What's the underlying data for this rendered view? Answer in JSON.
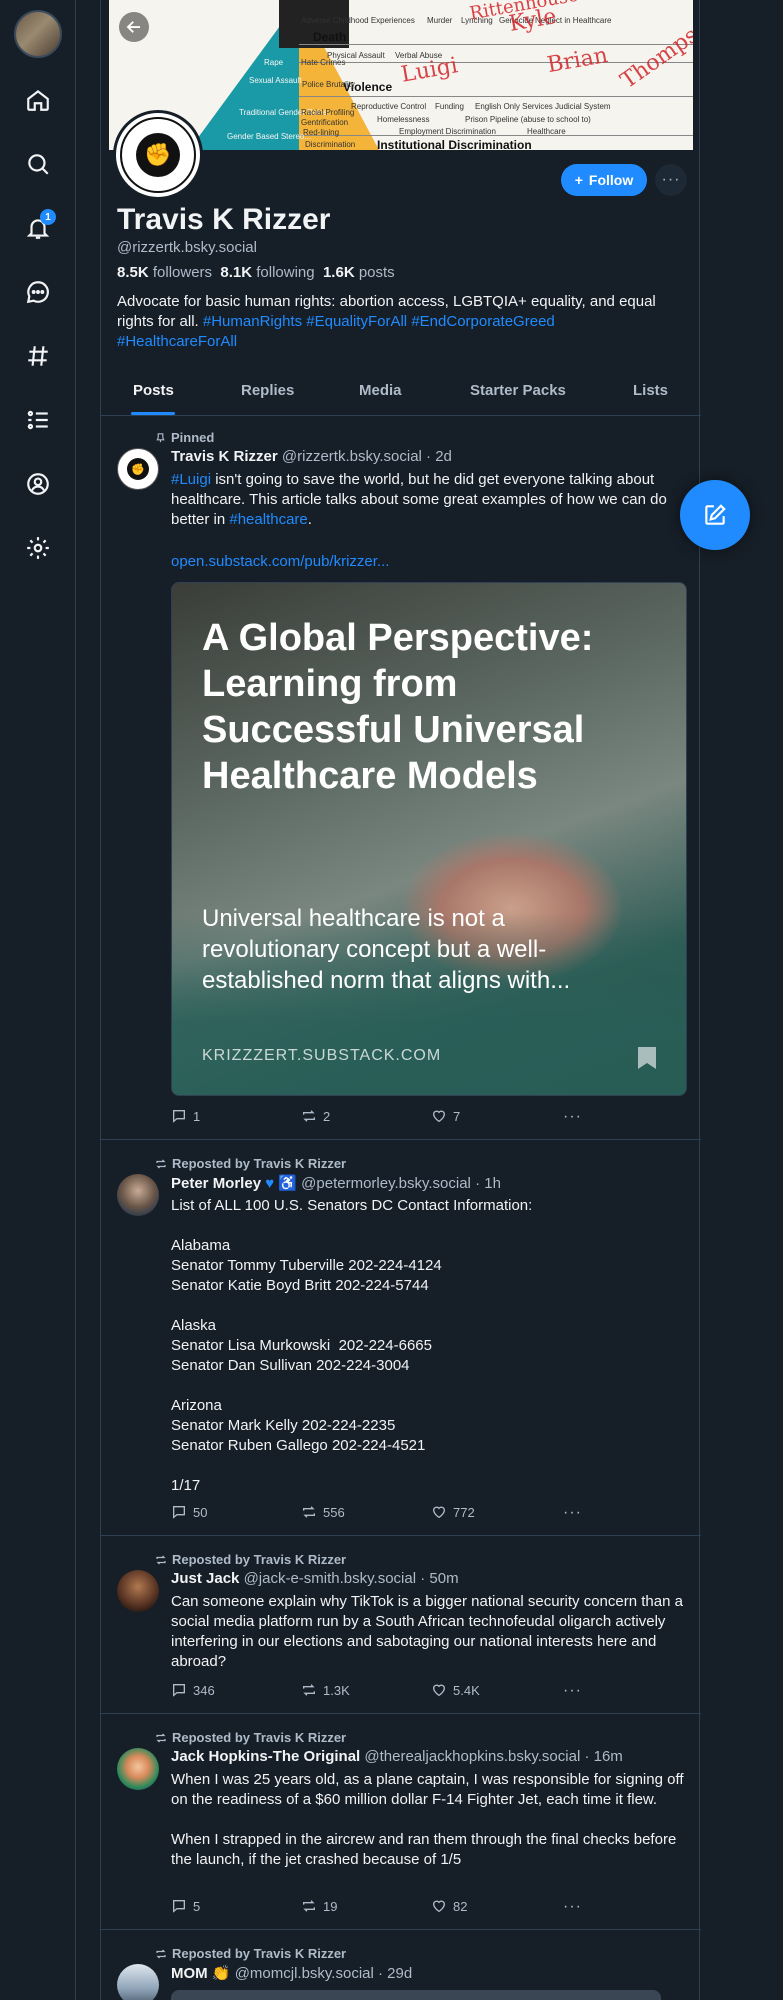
{
  "nav": {
    "notifications_badge": "1",
    "items": [
      "home-icon",
      "search-icon",
      "bell-icon",
      "chat-icon",
      "hashtag-icon",
      "list-icon",
      "profile-icon",
      "gear-icon"
    ]
  },
  "banner": {
    "top_label": "Adverse Childhood Experiences",
    "words": [
      "Murder",
      "Lynching",
      "Genocide",
      "Neglect in Healthcare"
    ],
    "death": "Death",
    "violence": "Violence",
    "row2": [
      "Physical Assault",
      "Verbal Abuse"
    ],
    "row4": [
      "Reproductive Control",
      "Funding",
      "English Only Services",
      "Judicial System"
    ],
    "row5": [
      "Homelessness",
      "Prison Pipeline (abuse to school to)"
    ],
    "row6": [
      "Employment Discrimination",
      "Healthcare"
    ],
    "bottom": "Institutional Discrimination",
    "left_labels": [
      "Rape",
      "Sexual Assault",
      "Traditional Gender Roles",
      "Gender Based Stereo..."
    ],
    "right_labels": [
      "Hate Crimes",
      "Police Brutality",
      "Racial Profiling",
      "Gentrification",
      "Red-lining",
      "Discrimination"
    ],
    "scribble_1": "Luigi",
    "scribble_2": "Kyle",
    "scribble_3": "Rittenhouse",
    "scribble_4": "Brian",
    "scribble_5": "Thompson"
  },
  "profile": {
    "name": "Travis K Rizzer",
    "handle": "@rizzertk.bsky.social",
    "followers": "8.5K",
    "followers_label": "followers",
    "following": "8.1K",
    "following_label": "following",
    "posts": "1.6K",
    "posts_label": "posts",
    "bio_text": "Advocate for basic human rights: abortion access, LGBTQIA+ equality, and equal rights for all. ",
    "bio_tags": [
      "#HumanRights",
      "#EqualityForAll",
      "#EndCorporateGreed",
      "#HealthcareForAll"
    ],
    "follow_label": "Follow"
  },
  "tabs": [
    "Posts",
    "Replies",
    "Media",
    "Starter Packs",
    "Lists"
  ],
  "posts": [
    {
      "context": "Pinned",
      "author": "Travis K Rizzer",
      "handle": "@rizzertk.bsky.social",
      "time": "· 2d",
      "tag1": "#Luigi",
      "text1": " isn't going to save the world, but he did get everyone talking about healthcare. This article talks about some great examples of how we can do better in ",
      "tag2": "#healthcare",
      "text2": ".",
      "link": "open.substack.com/pub/krizzer...",
      "card": {
        "title": "A Global Perspective: Learning from Successful Universal Healthcare Models",
        "description": "Universal healthcare is not a revolutionary concept but a well-established norm that aligns with...",
        "domain": "KRIZZZERT.SUBSTACK.COM"
      },
      "replies": "1",
      "reposts": "2",
      "likes": "7"
    },
    {
      "context": "Reposted by Travis K Rizzer",
      "author": "Peter Morley",
      "handle": "@petermorley.bsky.social",
      "time": "· 1h",
      "text": "List of ALL 100 U.S. Senators DC Contact Information:\n\nAlabama\nSenator Tommy Tuberville 202-224-4124\nSenator Katie Boyd Britt 202-224-5744\n\nAlaska\nSenator Lisa Murkowski  202-224-6665\nSenator Dan Sullivan 202-224-3004\n\nArizona\nSenator Mark Kelly 202-224-2235\nSenator Ruben Gallego 202-224-4521\n\n1/17",
      "replies": "50",
      "reposts": "556",
      "likes": "772"
    },
    {
      "context": "Reposted by Travis K Rizzer",
      "author": "Just Jack",
      "handle": "@jack-e-smith.bsky.social",
      "time": "· 50m",
      "text": "Can someone explain why TikTok is a bigger national security concern than a social media platform run by a South African technofeudal oligarch actively interfering in our elections and sabotaging our national interests here and abroad?",
      "replies": "346",
      "reposts": "1.3K",
      "likes": "5.4K"
    },
    {
      "context": "Reposted by Travis K Rizzer",
      "author": "Jack Hopkins-The Original",
      "handle": "@therealjackhopkins.bsky.social",
      "time": "· 16m",
      "text": "When I was 25 years old, as a plane captain, I was responsible for signing off on the readiness of a $60 million dollar F-14 Fighter Jet, each time it flew.\n\nWhen I strapped in the aircrew and ran them through the final checks before the launch, if the jet crashed because of 1/5",
      "replies": "5",
      "reposts": "19",
      "likes": "82"
    },
    {
      "context": "Reposted by Travis K Rizzer",
      "author": "MOM 👏",
      "handle": "@momcjl.bsky.social",
      "time": "· 29d"
    }
  ]
}
